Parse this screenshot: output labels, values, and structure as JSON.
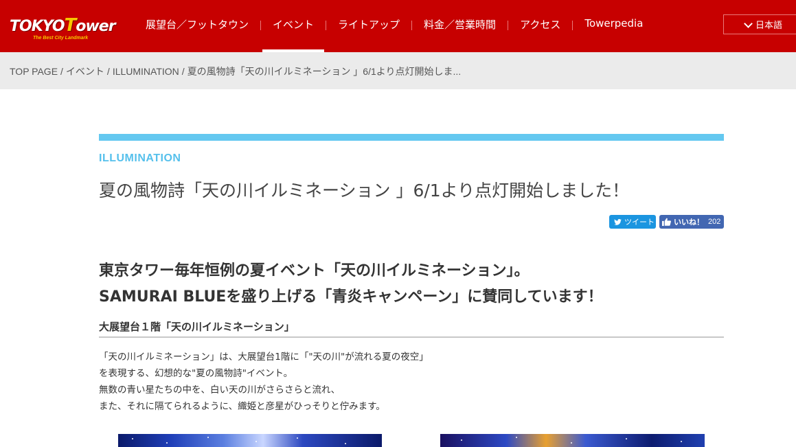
{
  "header": {
    "logo_main": "TOKYOTower",
    "logo_sub": "The Best City Landmark",
    "nav": [
      {
        "label": "展望台／フットタウン"
      },
      {
        "label": "イベント"
      },
      {
        "label": "ライトアップ"
      },
      {
        "label": "料金／営業時間"
      },
      {
        "label": "アクセス"
      },
      {
        "label": "Towerpedia"
      }
    ],
    "active_index": 1,
    "language": "日本語"
  },
  "breadcrumb": [
    "TOP PAGE",
    "イベント",
    "ILLUMINATION",
    "夏の風物詩「天の川イルミネーション 」6/1より点灯開始しま..."
  ],
  "article": {
    "category": "ILLUMINATION",
    "title": "夏の風物詩「天の川イルミネーション 」6/1より点灯開始しました！",
    "tweet_label": "ツイート",
    "like_label": "いいね！",
    "like_count": "202",
    "lead_line1": "東京タワー毎年恒例の夏イベント「天の川イルミネーション」。",
    "lead_line2": "SAMURAI BLUEを盛り上げる「青炎キャンペーン」に賛同しています！",
    "subhead": "大展望台１階「天の川イルミネーション」",
    "body_lines": [
      "「天の川イルミネーション」は、大展望台1階に「\"天の川\"が流れる夏の夜空」",
      "を表現する、幻想的な\"夏の風物詩\"イベント。",
      "無数の青い星たちの中を、白い天の川がさらさらと流れ、",
      "また、それに隔てられるように、織姫と彦星がひっそりと佇みます。"
    ]
  },
  "colors": {
    "header_red": "#c70000",
    "accent_blue": "#64c8f0",
    "twitter_blue": "#1b95e0",
    "facebook_blue": "#4267b2"
  }
}
